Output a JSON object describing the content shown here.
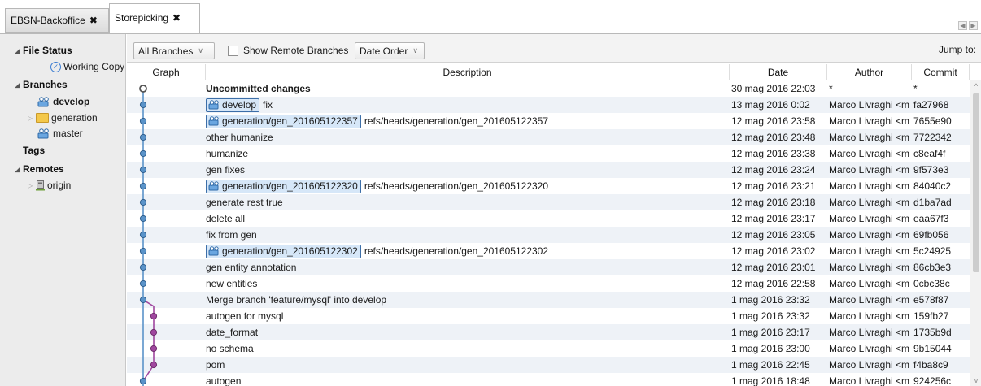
{
  "tabs": [
    {
      "label": "EBSN-Backoffice",
      "close": "✖",
      "active": false
    },
    {
      "label": "Storepicking",
      "close": "✖",
      "active": true
    }
  ],
  "tab_nav": {
    "prev": "◀",
    "next": "▶"
  },
  "sidebar": {
    "file_status": {
      "label": "File Status",
      "items": [
        {
          "label": "Working Copy"
        }
      ]
    },
    "branches": {
      "label": "Branches",
      "items": [
        {
          "label": "develop",
          "current": true
        },
        {
          "label": "generation",
          "folder": true
        },
        {
          "label": "master"
        }
      ]
    },
    "tags": {
      "label": "Tags"
    },
    "remotes": {
      "label": "Remotes",
      "items": [
        {
          "label": "origin"
        }
      ]
    }
  },
  "toolbar": {
    "branches_dropdown": "All Branches",
    "show_remote_label": "Show Remote Branches",
    "show_remote_checked": false,
    "order_dropdown": "Date Order",
    "jump_to": "Jump to:"
  },
  "columns": {
    "graph": "Graph",
    "description": "Description",
    "date": "Date",
    "author": "Author",
    "commit": "Commit"
  },
  "commits": [
    {
      "description": "Uncommitted changes",
      "bold": true,
      "date": "30 mag 2016 22:03",
      "author": "*",
      "commit": "*",
      "lane": 0,
      "uncommitted": true
    },
    {
      "ref": "develop",
      "description": "fix",
      "date": "13 mag 2016 0:02",
      "author": "Marco Livraghi <m",
      "commit": "fa27968",
      "lane": 0
    },
    {
      "ref": "generation/gen_201605122357",
      "description": "refs/heads/generation/gen_201605122357",
      "date": "12 mag 2016 23:58",
      "author": "Marco Livraghi <m",
      "commit": "7655e90",
      "lane": 0
    },
    {
      "description": "other humanize",
      "date": "12 mag 2016 23:48",
      "author": "Marco Livraghi <m",
      "commit": "7722342",
      "lane": 0
    },
    {
      "description": "humanize",
      "date": "12 mag 2016 23:38",
      "author": "Marco Livraghi <m",
      "commit": "c8eaf4f",
      "lane": 0
    },
    {
      "description": "gen fixes",
      "date": "12 mag 2016 23:24",
      "author": "Marco Livraghi <m",
      "commit": "9f573e3",
      "lane": 0
    },
    {
      "ref": "generation/gen_201605122320",
      "description": "refs/heads/generation/gen_201605122320",
      "date": "12 mag 2016 23:21",
      "author": "Marco Livraghi <m",
      "commit": "84040c2",
      "lane": 0
    },
    {
      "description": "generate rest true",
      "date": "12 mag 2016 23:18",
      "author": "Marco Livraghi <m",
      "commit": "d1ba7ad",
      "lane": 0
    },
    {
      "description": "delete all",
      "date": "12 mag 2016 23:17",
      "author": "Marco Livraghi <m",
      "commit": "eaa67f3",
      "lane": 0
    },
    {
      "description": "fix from gen",
      "date": "12 mag 2016 23:05",
      "author": "Marco Livraghi <m",
      "commit": "69fb056",
      "lane": 0
    },
    {
      "ref": "generation/gen_201605122302",
      "description": "refs/heads/generation/gen_201605122302",
      "date": "12 mag 2016 23:02",
      "author": "Marco Livraghi <m",
      "commit": "5c24925",
      "lane": 0
    },
    {
      "description": "gen entity annotation",
      "date": "12 mag 2016 23:01",
      "author": "Marco Livraghi <m",
      "commit": "86cb3e3",
      "lane": 0
    },
    {
      "description": "new entities",
      "date": "12 mag 2016 22:58",
      "author": "Marco Livraghi <m",
      "commit": "0cbc38c",
      "lane": 0
    },
    {
      "description": "Merge branch 'feature/mysql' into develop",
      "date": "1 mag 2016 23:32",
      "author": "Marco Livraghi <m",
      "commit": "e578f87",
      "lane": 0,
      "merge": true
    },
    {
      "description": "autogen for mysql",
      "date": "1 mag 2016 23:32",
      "author": "Marco Livraghi <m",
      "commit": "159fb27",
      "lane": 1
    },
    {
      "description": "date_format",
      "date": "1 mag 2016 23:17",
      "author": "Marco Livraghi <m",
      "commit": "1735b9d",
      "lane": 1
    },
    {
      "description": "no schema",
      "date": "1 mag 2016 23:00",
      "author": "Marco Livraghi <m",
      "commit": "9b15044",
      "lane": 1
    },
    {
      "description": "pom",
      "date": "1 mag 2016 22:45",
      "author": "Marco Livraghi <m",
      "commit": "f4ba8c9",
      "lane": 1
    },
    {
      "description": "autogen",
      "date": "1 mag 2016 18:48",
      "author": "Marco Livraghi <m",
      "commit": "924256c",
      "lane": 0
    }
  ],
  "colors": {
    "lane0": "#5a93c9",
    "lane1": "#a0479f",
    "ref_bg": "#d6e7f8",
    "ref_border": "#3c6ea8",
    "row_alt": "#eef2f7"
  },
  "scrollbar": {
    "up": "^",
    "down": "v"
  }
}
